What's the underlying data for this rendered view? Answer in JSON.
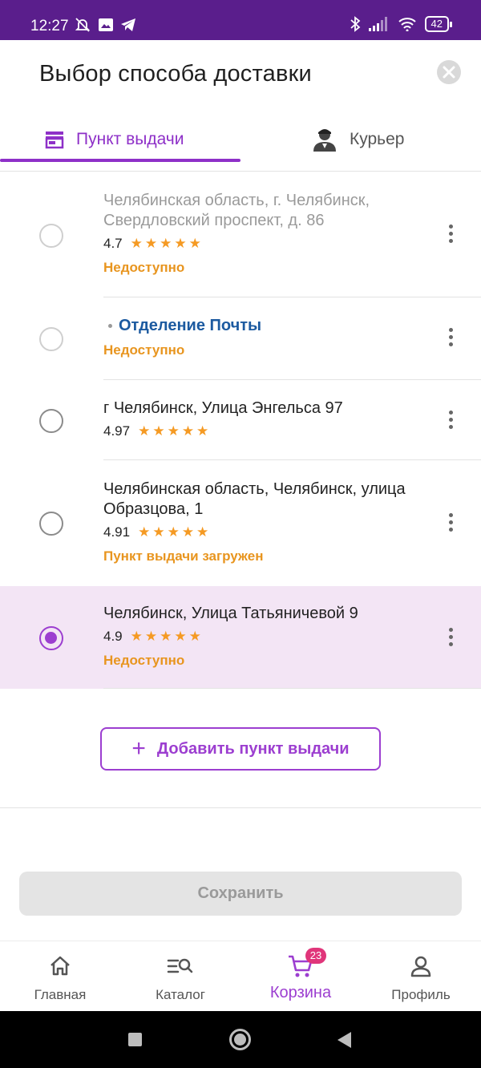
{
  "status_bar": {
    "time": "12:27",
    "battery": "42"
  },
  "sheet": {
    "title": "Выбор способа доставки"
  },
  "tabs": [
    {
      "label": "Пункт выдачи",
      "icon": "store-icon",
      "active": true
    },
    {
      "label": "Курьер",
      "icon": "courier-icon",
      "active": false
    }
  ],
  "points": [
    {
      "address": "Челябинская область, г. Челябинск, Свердловский проспект, д. 86",
      "rating": "4.7",
      "stars": "★★★★★",
      "status": "Недоступно",
      "selected": false,
      "disabled": true
    },
    {
      "title": "Отделение Почты",
      "status": "Недоступно",
      "selected": false,
      "disabled": true
    },
    {
      "address": "г Челябинск, Улица Энгельса 97",
      "rating": "4.97",
      "stars": "★★★★★",
      "selected": false,
      "disabled": false
    },
    {
      "address": "Челябинская область, Челябинск, улица Образцова, 1",
      "rating": "4.91",
      "stars": "★★★★★",
      "status": "Пункт выдачи загружен",
      "selected": false,
      "disabled": false
    },
    {
      "address": "Челябинск, Улица Татьяничевой 9",
      "rating": "4.9",
      "stars": "★★★★★",
      "status": "Недоступно",
      "selected": true,
      "disabled": false
    }
  ],
  "actions": {
    "add_pickup_label": "Добавить пункт выдачи",
    "save_label": "Сохранить"
  },
  "bottom_nav": [
    {
      "label": "Главная",
      "icon": "home-icon"
    },
    {
      "label": "Каталог",
      "icon": "catalog-search-icon"
    },
    {
      "label": "Корзина",
      "icon": "cart-icon",
      "badge": "23",
      "active": true
    },
    {
      "label": "Профиль",
      "icon": "profile-icon"
    }
  ],
  "colors": {
    "accent": "#9c3ed0",
    "status_bar": "#5a1e8c",
    "warning": "#e8951f",
    "link": "#1c5aa0",
    "selected_bg": "#f3e5f5"
  }
}
